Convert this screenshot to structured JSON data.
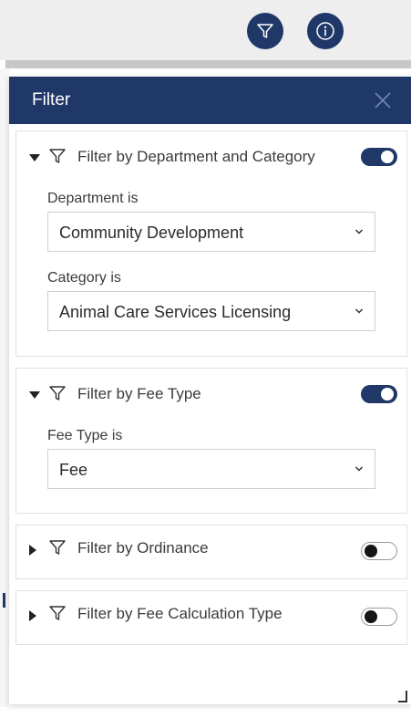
{
  "toolbar": {
    "filter_icon": "filter-icon",
    "info_icon": "info-icon",
    "accent_color": "#1f3868"
  },
  "panel": {
    "title": "Filter",
    "close_icon": "close-icon"
  },
  "filters": [
    {
      "title": "Filter by Department and Category",
      "expanded": true,
      "enabled": true,
      "fields": [
        {
          "label": "Department is",
          "value": "Community Development"
        },
        {
          "label": "Category is",
          "value": "Animal Care Services Licensing"
        }
      ]
    },
    {
      "title": "Filter by Fee Type",
      "expanded": true,
      "enabled": true,
      "fields": [
        {
          "label": "Fee Type is",
          "value": "Fee"
        }
      ]
    },
    {
      "title": "Filter by Ordinance",
      "expanded": false,
      "enabled": false
    },
    {
      "title": "Filter by Fee Calculation Type",
      "expanded": false,
      "enabled": false
    }
  ]
}
